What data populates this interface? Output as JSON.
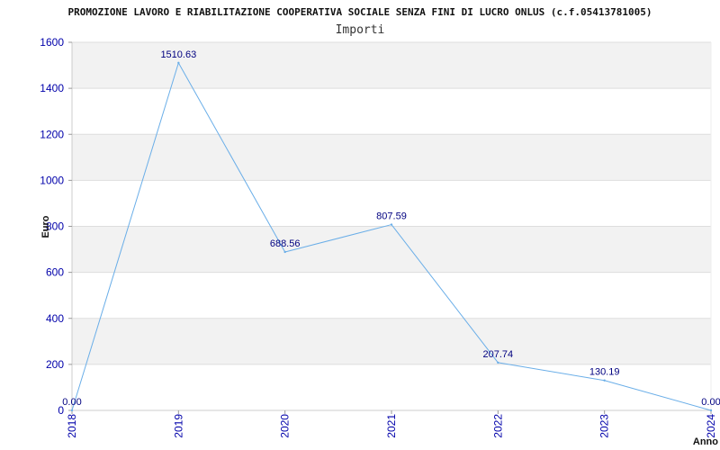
{
  "chart_data": {
    "type": "line",
    "title": "PROMOZIONE LAVORO E RIABILITAZIONE COOPERATIVA SOCIALE SENZA FINI DI LUCRO ONLUS (c.f.05413781005)",
    "subtitle": "Importi",
    "xlabel": "Anno",
    "ylabel": "Euro",
    "categories": [
      "2018",
      "2019",
      "2020",
      "2021",
      "2022",
      "2023",
      "2024"
    ],
    "values": [
      0.0,
      1510.63,
      688.56,
      807.59,
      207.74,
      130.19,
      0.0
    ],
    "data_labels": [
      "0.00",
      "1510.63",
      "688.56",
      "807.59",
      "207.74",
      "130.19",
      "0.00"
    ],
    "ylim": [
      0,
      1600
    ],
    "yticks": [
      0,
      200,
      400,
      600,
      800,
      1000,
      1200,
      1400,
      1600
    ],
    "grid": true,
    "colors": {
      "line": "#6aaee8",
      "band": "#f2f2f2",
      "grid": "#dddddd",
      "tick_text": "#0000aa",
      "data_label": "#000080"
    }
  }
}
